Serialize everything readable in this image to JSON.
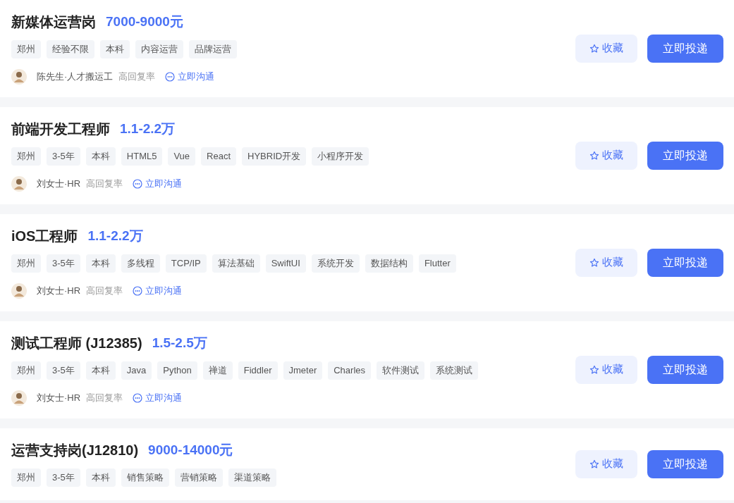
{
  "jobs": [
    {
      "title": "新媒体运营岗",
      "salary": "7000-9000元",
      "tags": [
        "郑州",
        "经验不限",
        "本科",
        "内容运营",
        "品牌运营"
      ],
      "recruiter": {
        "name": "陈先生·人才搬运工",
        "badge": "高回复率",
        "chat": "立即沟通"
      },
      "favorite": "收藏",
      "apply": "立即投递"
    },
    {
      "title": "前端开发工程师",
      "salary": "1.1-2.2万",
      "tags": [
        "郑州",
        "3-5年",
        "本科",
        "HTML5",
        "Vue",
        "React",
        "HYBRID开发",
        "小程序开发"
      ],
      "recruiter": {
        "name": "刘女士·HR",
        "badge": "高回复率",
        "chat": "立即沟通"
      },
      "favorite": "收藏",
      "apply": "立即投递"
    },
    {
      "title": "iOS工程师",
      "salary": "1.1-2.2万",
      "tags": [
        "郑州",
        "3-5年",
        "本科",
        "多线程",
        "TCP/IP",
        "算法基础",
        "SwiftUI",
        "系统开发",
        "数据结构",
        "Flutter"
      ],
      "recruiter": {
        "name": "刘女士·HR",
        "badge": "高回复率",
        "chat": "立即沟通"
      },
      "favorite": "收藏",
      "apply": "立即投递"
    },
    {
      "title": "测试工程师 (J12385)",
      "salary": "1.5-2.5万",
      "tags": [
        "郑州",
        "3-5年",
        "本科",
        "Java",
        "Python",
        "禅道",
        "Fiddler",
        "Jmeter",
        "Charles",
        "软件测试",
        "系统测试"
      ],
      "recruiter": {
        "name": "刘女士·HR",
        "badge": "高回复率",
        "chat": "立即沟通"
      },
      "favorite": "收藏",
      "apply": "立即投递"
    },
    {
      "title": "运营支持岗(J12810)",
      "salary": "9000-14000元",
      "tags": [
        "郑州",
        "3-5年",
        "本科",
        "销售策略",
        "营销策略",
        "渠道策略"
      ],
      "favorite": "收藏",
      "apply": "立即投递"
    }
  ]
}
